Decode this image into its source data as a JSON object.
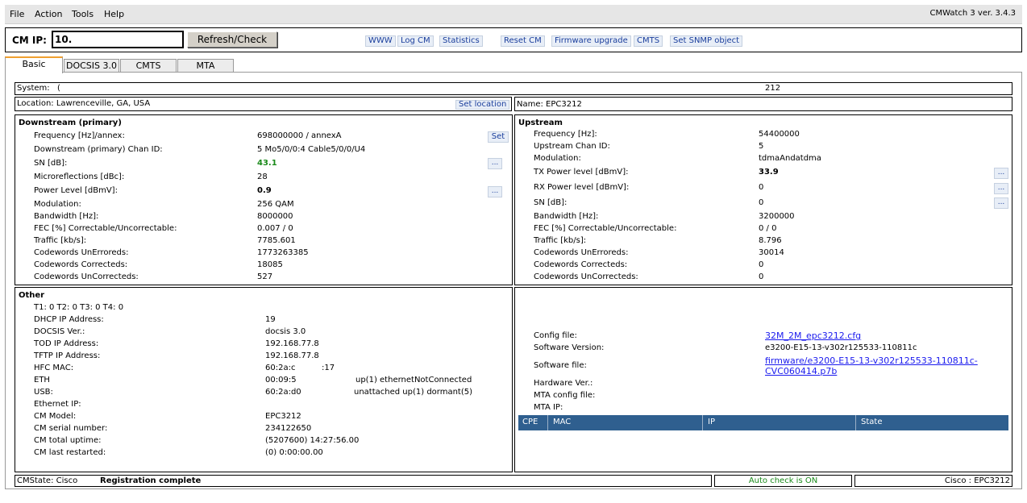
{
  "menu": {
    "file": "File",
    "action": "Action",
    "tools": "Tools",
    "help": "Help"
  },
  "app_version": "CMWatch 3 ver. 3.4.3",
  "toolbar": {
    "cm_ip_label": "CM IP:",
    "cm_ip_value": "10.",
    "refresh_label": "Refresh/Check",
    "links": {
      "www": "WWW",
      "log_cm": "Log CM",
      "statistics": "Statistics",
      "reset_cm": "Reset CM",
      "firmware_upgrade": "Firmware upgrade",
      "cmts": "CMTS",
      "set_snmp": "Set SNMP object"
    }
  },
  "tabs": {
    "basic": "Basic",
    "docsis": "DOCSIS 3.0",
    "cmts": "CMTS",
    "mta": "MTA"
  },
  "system": {
    "label": "System:",
    "value_prefix": "(",
    "value_suffix": "212"
  },
  "location": {
    "label": "Location: Lawrenceville, GA, USA",
    "set_location": "Set location"
  },
  "name": {
    "label": "Name: EPC3212"
  },
  "downstream": {
    "title": "Downstream (primary)",
    "set_label": "Set",
    "dots": "...",
    "rows": [
      {
        "label": "Frequency [Hz]/annex:",
        "value": "698000000 / annexA"
      },
      {
        "label": "Downstream (primary) Chan ID:",
        "value": "5     Mo5/0/0:4 Cable5/0/0/U4"
      },
      {
        "label": "SN [dB]:",
        "value": "43.1"
      },
      {
        "label": "Microreflections [dBc]:",
        "value": "28"
      },
      {
        "label": "Power Level [dBmV]:",
        "value": "0.9"
      },
      {
        "label": "Modulation:",
        "value": "256 QAM"
      },
      {
        "label": "Bandwidth [Hz]:",
        "value": "8000000"
      },
      {
        "label": "FEC [%] Correctable/Uncorrectable:",
        "value": "0.007 / 0"
      },
      {
        "label": "Traffic [kb/s]:",
        "value": "7785.601"
      },
      {
        "label": "Codewords UnErroreds:",
        "value": "1773263385"
      },
      {
        "label": "Codewords Correcteds:",
        "value": "18085"
      },
      {
        "label": "Codewords UnCorrecteds:",
        "value": "527"
      }
    ]
  },
  "upstream": {
    "title": "Upstream",
    "dots": "...",
    "rows": [
      {
        "label": "Frequency [Hz]:",
        "value": "54400000"
      },
      {
        "label": "Upstream Chan ID:",
        "value": "5"
      },
      {
        "label": "Modulation:",
        "value": "tdmaAndatdma"
      },
      {
        "label": "TX Power level [dBmV]:",
        "value": "33.9"
      },
      {
        "label": "RX Power level [dBmV]:",
        "value": "0"
      },
      {
        "label": "SN [dB]:",
        "value": "0"
      },
      {
        "label": "Bandwidth [Hz]:",
        "value": "3200000"
      },
      {
        "label": "FEC [%] Correctable/Uncorrectable:",
        "value": "0 / 0"
      },
      {
        "label": "Traffic [kb/s]:",
        "value": "8.796"
      },
      {
        "label": "Codewords UnErroreds:",
        "value": "30014"
      },
      {
        "label": "Codewords Correcteds:",
        "value": "0"
      },
      {
        "label": "Codewords UnCorrecteds:",
        "value": "0"
      }
    ]
  },
  "other": {
    "title": "Other",
    "t_line": "T1: 0 T2: 0 T3: 0 T4: 0",
    "rows": [
      {
        "label": "DHCP IP Address:",
        "value": "19"
      },
      {
        "label": "DOCSIS Ver.:",
        "value": "docsis 3.0"
      },
      {
        "label": "TOD IP Address:",
        "value": "192.168.77.8"
      },
      {
        "label": "TFTP IP Address:",
        "value": "192.168.77.8"
      },
      {
        "label": "HFC MAC:",
        "value": "60:2a:c",
        "value2": ":17"
      },
      {
        "label": "ETH",
        "value": "00:09:5",
        "value2": "up(1) ethernetNotConnected"
      },
      {
        "label": "USB:",
        "value": "60:2a:d0",
        "value2": "unattached up(1) dormant(5)"
      },
      {
        "label": "Ethernet IP:",
        "value": ""
      },
      {
        "label": "CM Model:",
        "value": "EPC3212"
      },
      {
        "label": "CM serial number:",
        "value": "234122650"
      },
      {
        "label": "CM total uptime:",
        "value": "(5207600) 14:27:56.00"
      },
      {
        "label": "CM last restarted:",
        "value": "(0) 0:00:00.00"
      }
    ]
  },
  "config": {
    "config_file_label": "Config file:",
    "config_file_value": "32M_2M_epc3212.cfg",
    "sw_version_label": "Software Version:",
    "sw_version_value": "e3200-E15-13-v302r125533-110811c",
    "sw_file_label": "Software file:",
    "sw_file_line1": "firmware/e3200-E15-13-v302r125533-110811c-",
    "sw_file_line2": "CVC060414.p7b",
    "hw_ver_label": "Hardware Ver.:",
    "mta_config_label": "MTA config file:",
    "mta_ip_label": "MTA IP:"
  },
  "cpe_table": {
    "headers": [
      "CPE",
      "MAC",
      "IP",
      "State"
    ]
  },
  "statusbar": {
    "cmstate_label": "CMState: Cisco",
    "cmstate_value": "Registration complete",
    "auto_check": "Auto check is ON",
    "device": "Cisco : EPC3212"
  },
  "colors": {
    "sn_green": "#1a8a1a",
    "auto_check_green": "#1a8a1a",
    "tab_highlight": "#f0a030",
    "table_header": "#2f5f8f"
  }
}
